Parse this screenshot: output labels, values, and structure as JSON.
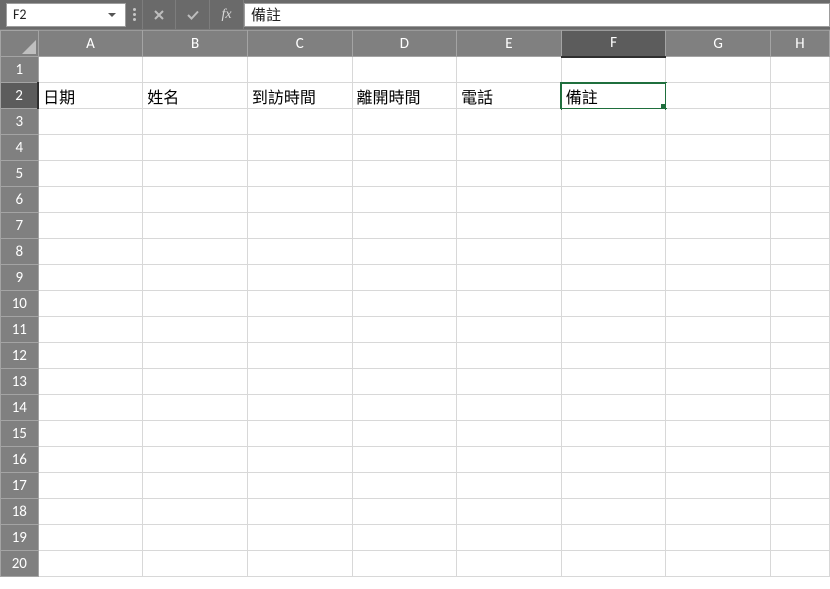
{
  "formula_bar": {
    "name_box": "F2",
    "fx_label": "fx",
    "formula_value": "備註"
  },
  "grid": {
    "columns": [
      "A",
      "B",
      "C",
      "D",
      "E",
      "F",
      "G",
      "H"
    ],
    "row_count": 20,
    "selected_cell": {
      "col": "F",
      "row": 2
    },
    "cells": {
      "A2": "日期",
      "B2": "姓名",
      "C2": "到訪時間",
      "D2": "離開時間",
      "E2": "電話",
      "F2": "備註"
    }
  }
}
